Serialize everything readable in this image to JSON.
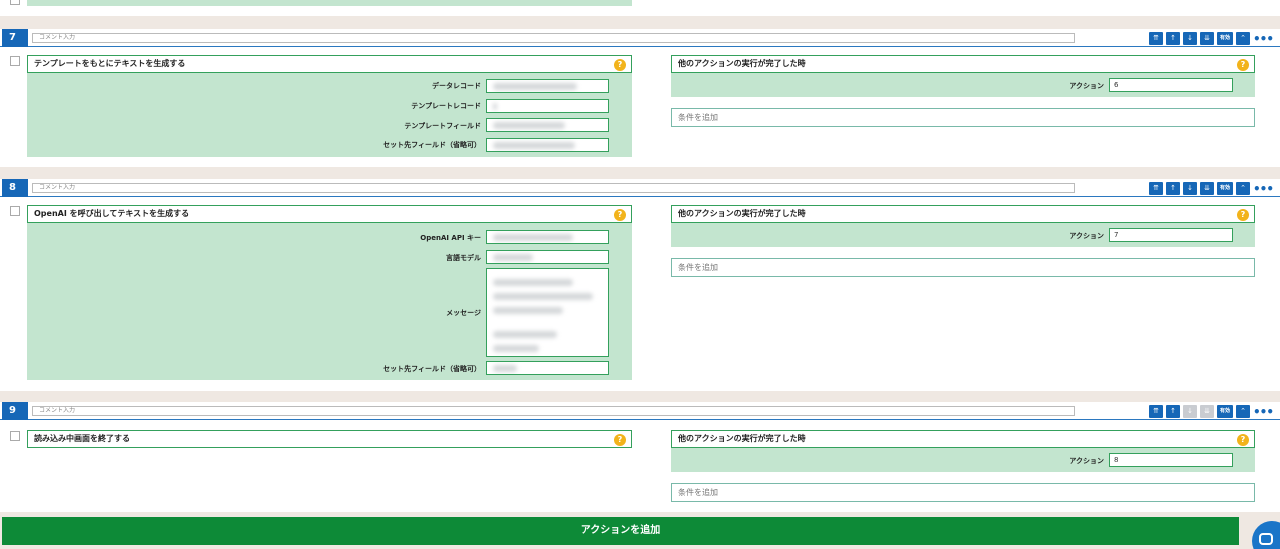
{
  "comment_placeholder": "コメント入力",
  "toolbar": {
    "top": "⇈",
    "up": "↑",
    "down": "↓",
    "bottom": "⇊",
    "enable": "有効",
    "collapse": "⌃",
    "more": "•••"
  },
  "condition": {
    "title": "他のアクションの実行が完了した時",
    "action_label": "アクション",
    "add_placeholder": "条件を追加"
  },
  "actions": [
    {
      "number": "7",
      "title": "テンプレートをもとにテキストを生成する",
      "fields": [
        {
          "label": "データレコード"
        },
        {
          "label": "テンプレートレコード"
        },
        {
          "label": "テンプレートフィールド"
        },
        {
          "label": "セット先フィールド（省略可）"
        }
      ],
      "condition_action_value": "6"
    },
    {
      "number": "8",
      "title": "OpenAI を呼び出してテキストを生成する",
      "fields": [
        {
          "label": "OpenAI API キー"
        },
        {
          "label": "言語モデル"
        },
        {
          "label": "メッセージ"
        },
        {
          "label": "セット先フィールド（省略可）"
        }
      ],
      "condition_action_value": "7"
    },
    {
      "number": "9",
      "title": "読み込み中画面を終了する",
      "fields": [],
      "condition_action_value": "8"
    }
  ],
  "add_action_label": "アクションを追加"
}
